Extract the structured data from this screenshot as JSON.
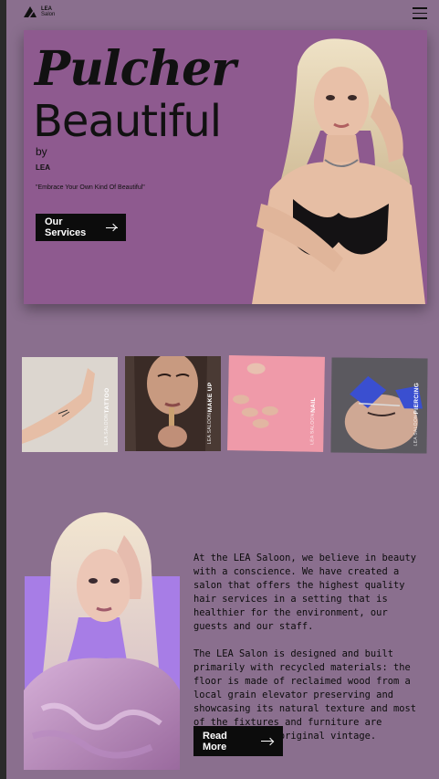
{
  "header": {
    "logo_line1": "LEA",
    "logo_line2": "Salon",
    "menu_icon": "hamburger-icon"
  },
  "hero": {
    "title_line1": "Pulcher",
    "title_line2": "Beautiful",
    "by": "by",
    "brand": "LEA",
    "tagline": "\"Embrace Your Own Kind Of Beautiful\"",
    "button_label": "Our Services",
    "button_icon": "arrow-right-icon",
    "background_color": "#8e5a8f"
  },
  "services": [
    {
      "small": "LEA SALOON",
      "name": "TATTOO"
    },
    {
      "small": "LEA SALOON",
      "name": "MAKE UP"
    },
    {
      "small": "LEA SALOON",
      "name": "NAIL"
    },
    {
      "small": "LEA SALOON",
      "name": "PIERCING"
    }
  ],
  "about": {
    "paragraph1": "At the LEA Saloon,  we believe in beauty with a conscience. We have created a salon that offers the highest quality hair services in a setting that is healthier for the environment, our guests and our staff.",
    "paragraph2": "The LEA Salon is designed and built primarily with recycled materials: the floor is made of reclaimed wood from a local grain elevator preserving and showcasing its natural texture and most of the fixtures and furniture are refurbished or original vintage.",
    "button_label": "Read More",
    "button_icon": "arrow-right-icon",
    "accent_color": "#a77de6"
  },
  "page": {
    "background_color": "#8a6f8e"
  }
}
